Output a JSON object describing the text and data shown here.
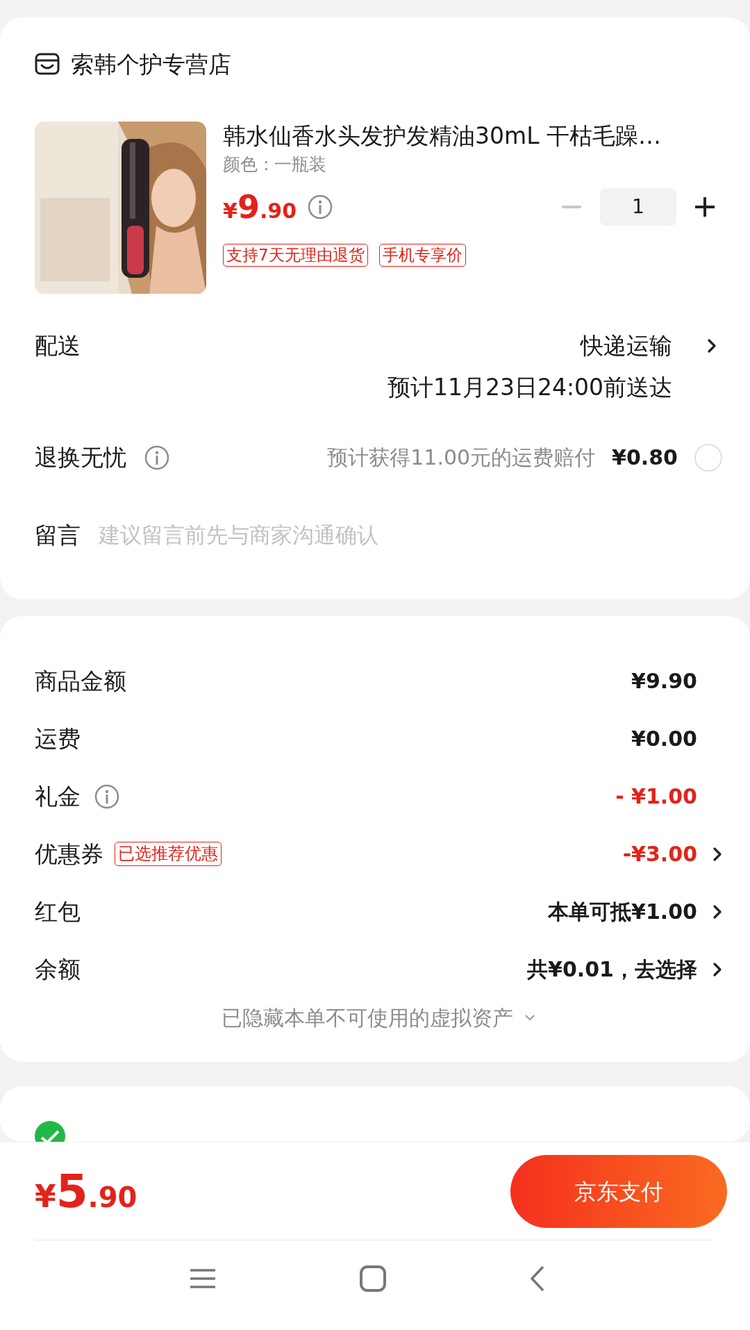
{
  "shop": {
    "name": "索韩个护专营店"
  },
  "product": {
    "title": "韩水仙香水头发护发精油30mL 干枯毛躁…",
    "variant": "颜色 : 一瓶装",
    "price": {
      "symbol": "¥",
      "integer": "9",
      "decimal": ".90"
    },
    "quantity": "1",
    "minus_disabled": true,
    "tags": [
      "支持7天无理由退货",
      "手机专享价"
    ]
  },
  "delivery": {
    "label": "配送",
    "method": "快递运输",
    "eta": "预计11月23日24:00前送达"
  },
  "return_insurance": {
    "label": "退换无忧",
    "note": "预计获得11.00元的运费赔付",
    "price": "¥0.80",
    "checked": false
  },
  "message": {
    "label": "留言",
    "placeholder": "建议留言前先与商家沟通确认"
  },
  "summary": [
    {
      "kind": "plain",
      "label": "商品金额",
      "value": "¥9.90",
      "negative": false,
      "chevron": false
    },
    {
      "kind": "plain",
      "label": "运费",
      "value": "¥0.00",
      "negative": false,
      "chevron": false
    },
    {
      "kind": "info",
      "label": "礼金",
      "value": "- ¥1.00",
      "negative": true,
      "chevron": false
    },
    {
      "kind": "tag",
      "label": "优惠券",
      "tag": "已选推荐优惠",
      "value": "-¥3.00",
      "negative": true,
      "chevron": true
    },
    {
      "kind": "plain",
      "label": "红包",
      "value": "本单可抵¥1.00",
      "negative": false,
      "chevron": true
    },
    {
      "kind": "plain",
      "label": "余额",
      "value": "共¥0.01，去选择",
      "negative": false,
      "chevron": true
    }
  ],
  "hidden_assets": {
    "text": "已隐藏本单不可使用的虚拟资产",
    "expanded": false
  },
  "total": {
    "symbol": "¥",
    "integer": "5",
    "decimal": ".90"
  },
  "pay_button": "京东支付"
}
